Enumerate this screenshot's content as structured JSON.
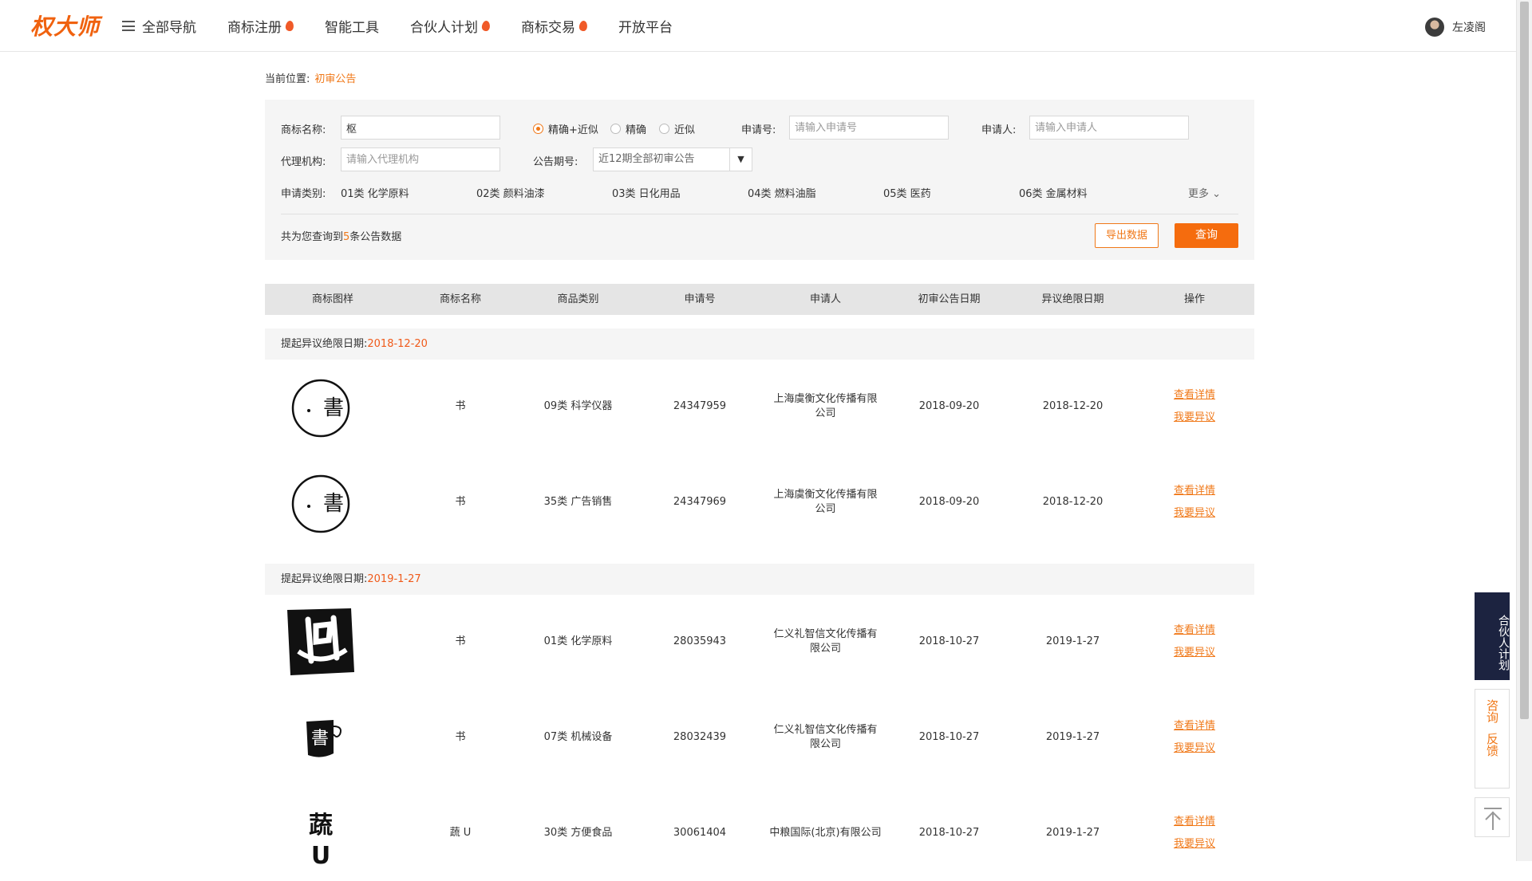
{
  "header": {
    "logo": "权大师",
    "nav": [
      {
        "label": "全部导航",
        "hot": false,
        "menu": true
      },
      {
        "label": "商标注册",
        "hot": true
      },
      {
        "label": "智能工具",
        "hot": false
      },
      {
        "label": "合伙人计划",
        "hot": true
      },
      {
        "label": "商标交易",
        "hot": true
      },
      {
        "label": "开放平台",
        "hot": false
      }
    ],
    "user_name": "左凌阁"
  },
  "breadcrumb": {
    "prefix": "当前位置:",
    "current": "初审公告"
  },
  "search": {
    "name_label": "商标名称:",
    "name_value": "枢",
    "match_options": [
      "精确+近似",
      "精确",
      "近似"
    ],
    "match_selected": 0,
    "appno_label": "申请号:",
    "appno_placeholder": "请输入申请号",
    "applicant_label": "申请人:",
    "applicant_placeholder": "请输入申请人",
    "agency_label": "代理机构:",
    "agency_placeholder": "请输入代理机构",
    "period_label": "公告期号:",
    "period_value": "近12期全部初审公告",
    "category_label": "申请类别:",
    "categories": [
      "01类 化学原料",
      "02类 颜料油漆",
      "03类 日化用品",
      "04类 燃料油脂",
      "05类 医药",
      "06类 金属材料"
    ],
    "more_label": "更多",
    "count_prefix": "共为您查询到",
    "count_value": "5",
    "count_suffix": "条公告数据",
    "export_label": "导出数据",
    "query_label": "查询"
  },
  "table": {
    "headers": [
      "商标图样",
      "商标名称",
      "商品类别",
      "申请号",
      "申请人",
      "初审公告日期",
      "异议绝限日期",
      "操作"
    ],
    "group_prefix": "提起异议绝限日期:",
    "groups": [
      {
        "date": "2018-12-20"
      },
      {
        "date": "2019-1-27"
      }
    ],
    "rows": [
      {
        "name": "书",
        "category": "09类 科学仪器",
        "appno": "24347959",
        "applicant": "上海虞衡文化传播有限公司",
        "pub_date": "2018-09-20",
        "deadline": "2018-12-20"
      },
      {
        "name": "书",
        "category": "35类 广告销售",
        "appno": "24347969",
        "applicant": "上海虞衡文化传播有限公司",
        "pub_date": "2018-09-20",
        "deadline": "2018-12-20"
      },
      {
        "name": "书",
        "category": "01类 化学原料",
        "appno": "28035943",
        "applicant": "仁义礼智信文化传播有限公司",
        "pub_date": "2018-10-27",
        "deadline": "2019-1-27"
      },
      {
        "name": "书",
        "category": "07类 机械设备",
        "appno": "28032439",
        "applicant": "仁义礼智信文化传播有限公司",
        "pub_date": "2018-10-27",
        "deadline": "2019-1-27"
      },
      {
        "name": "蔬 U",
        "category": "30类 方便食品",
        "appno": "30061404",
        "applicant": "中粮国际(北京)有限公司",
        "pub_date": "2018-10-27",
        "deadline": "2019-1-27"
      }
    ],
    "op_detail": "查看详情",
    "op_object": "我要异议"
  },
  "side": {
    "partner": "合伙人计划",
    "consult": "咨询",
    "feedback": "反馈"
  },
  "colors": {
    "accent": "#f07818",
    "query_button": "#f56c0e",
    "partner_bg": "#1c2340"
  }
}
